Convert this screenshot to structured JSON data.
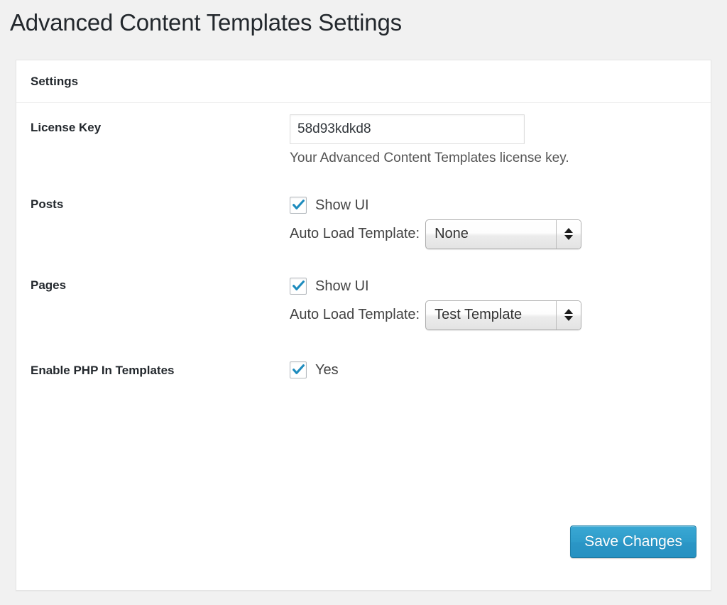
{
  "page": {
    "title": "Advanced Content Templates Settings",
    "background_color": "#f1f1f1"
  },
  "panel": {
    "header_title": "Settings",
    "border_color": "#e5e5e5"
  },
  "settings": {
    "license": {
      "label": "License Key",
      "value": "58d93kdkd8",
      "placeholder": "",
      "description": "Your Advanced Content Templates license key."
    },
    "posts": {
      "label": "Posts",
      "show_ui_label": "Show UI",
      "show_ui_checked": true,
      "auto_load_caption": "Auto Load Template:",
      "auto_load_value": "None",
      "auto_load_options": [
        "None",
        "Test Template"
      ]
    },
    "pages": {
      "label": "Pages",
      "show_ui_label": "Show UI",
      "show_ui_checked": true,
      "auto_load_caption": "Auto Load Template:",
      "auto_load_value": "Test Template",
      "auto_load_options": [
        "None",
        "Test Template"
      ]
    },
    "php": {
      "label": "Enable PHP In Templates",
      "yes_label": "Yes",
      "checked": true
    }
  },
  "submit": {
    "save_label": "Save Changes",
    "accent_color": "#2e9cca"
  },
  "icons": {
    "check": "check-icon",
    "select_arrows": "sort-arrows-icon"
  }
}
